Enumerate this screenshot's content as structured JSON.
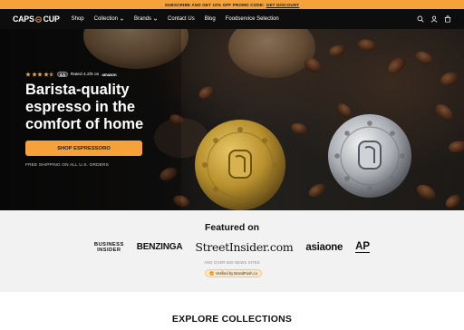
{
  "announcement": {
    "text": "Subscribe and get 10% off promo code:",
    "code": "GET DISCOUNT"
  },
  "header": {
    "logo_left": "CAPS",
    "logo_right": "CUP",
    "nav": [
      {
        "label": "Shop",
        "dropdown": false
      },
      {
        "label": "Collection",
        "dropdown": true
      },
      {
        "label": "Brands",
        "dropdown": true
      },
      {
        "label": "Contact Us",
        "dropdown": false
      },
      {
        "label": "Blog",
        "dropdown": false
      },
      {
        "label": "Foodservice Selection",
        "dropdown": false
      }
    ],
    "icons": [
      "search-icon",
      "account-icon",
      "cart-icon"
    ]
  },
  "hero": {
    "rating_value": 4.5,
    "rating_badge": "4.5",
    "rating_text": "Rated 4.2/5 on",
    "rating_source": "amazon",
    "title": "Barista-quality espresso in the comfort of home",
    "cta": "Shop Espressoro",
    "shipping": "Free shipping on all U.S. orders"
  },
  "featured": {
    "title": "Featured on",
    "logos": {
      "business_insider_1": "BUSINESS",
      "business_insider_2": "INSIDER",
      "benzinga": "BENZINGA",
      "streetinsider": "StreetInsider.com",
      "asiaone": "asiaone",
      "ap": "AP"
    },
    "subtitle": "And over 500 news sites",
    "verified": "Verified by BrandPush.co"
  },
  "explore": {
    "title": "EXPLORE COLLECTIONS"
  },
  "colors": {
    "accent": "#f5a23a",
    "header_bg": "#0d0d0d",
    "featured_bg": "#f2f2f2"
  }
}
